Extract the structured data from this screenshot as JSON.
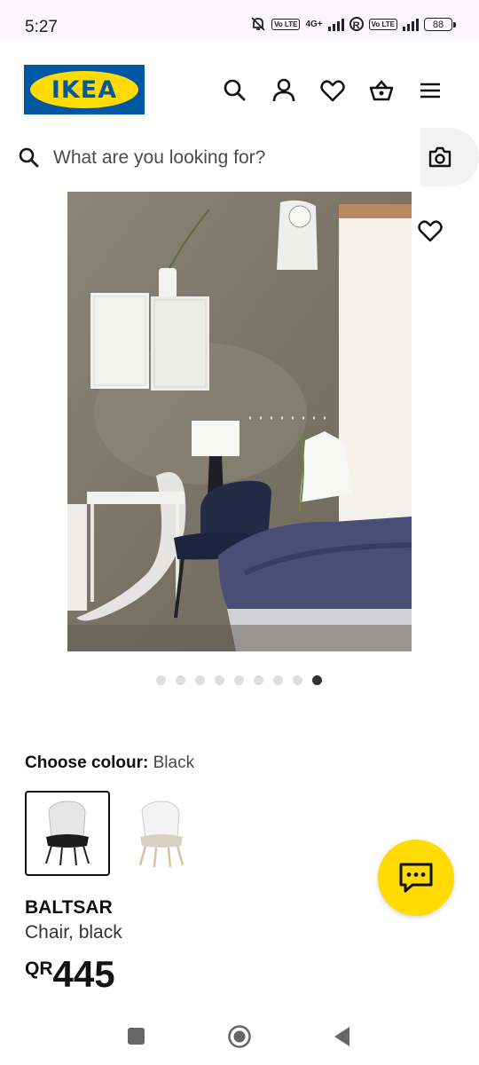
{
  "status_bar": {
    "time": "5:27",
    "network": "4G+",
    "volte_1": "Vo LTE",
    "volte_2": "Vo LTE",
    "r": "R",
    "battery": "88"
  },
  "header": {
    "logo_text": "IKEA",
    "icons": [
      "search-icon",
      "account-icon",
      "heart-icon",
      "basket-icon",
      "menu-icon"
    ]
  },
  "search": {
    "placeholder": "What are you looking for?"
  },
  "carousel": {
    "total": 9,
    "active_index": 8
  },
  "colour": {
    "label": "Choose colour:",
    "selected": "Black",
    "options": [
      "black-chair",
      "white-chair"
    ]
  },
  "product": {
    "name": "BALTSAR",
    "description": "Chair, black",
    "currency": "QR",
    "price": "445"
  },
  "colors": {
    "ikea_blue": "#0058a3",
    "ikea_yellow": "#ffdb00"
  }
}
